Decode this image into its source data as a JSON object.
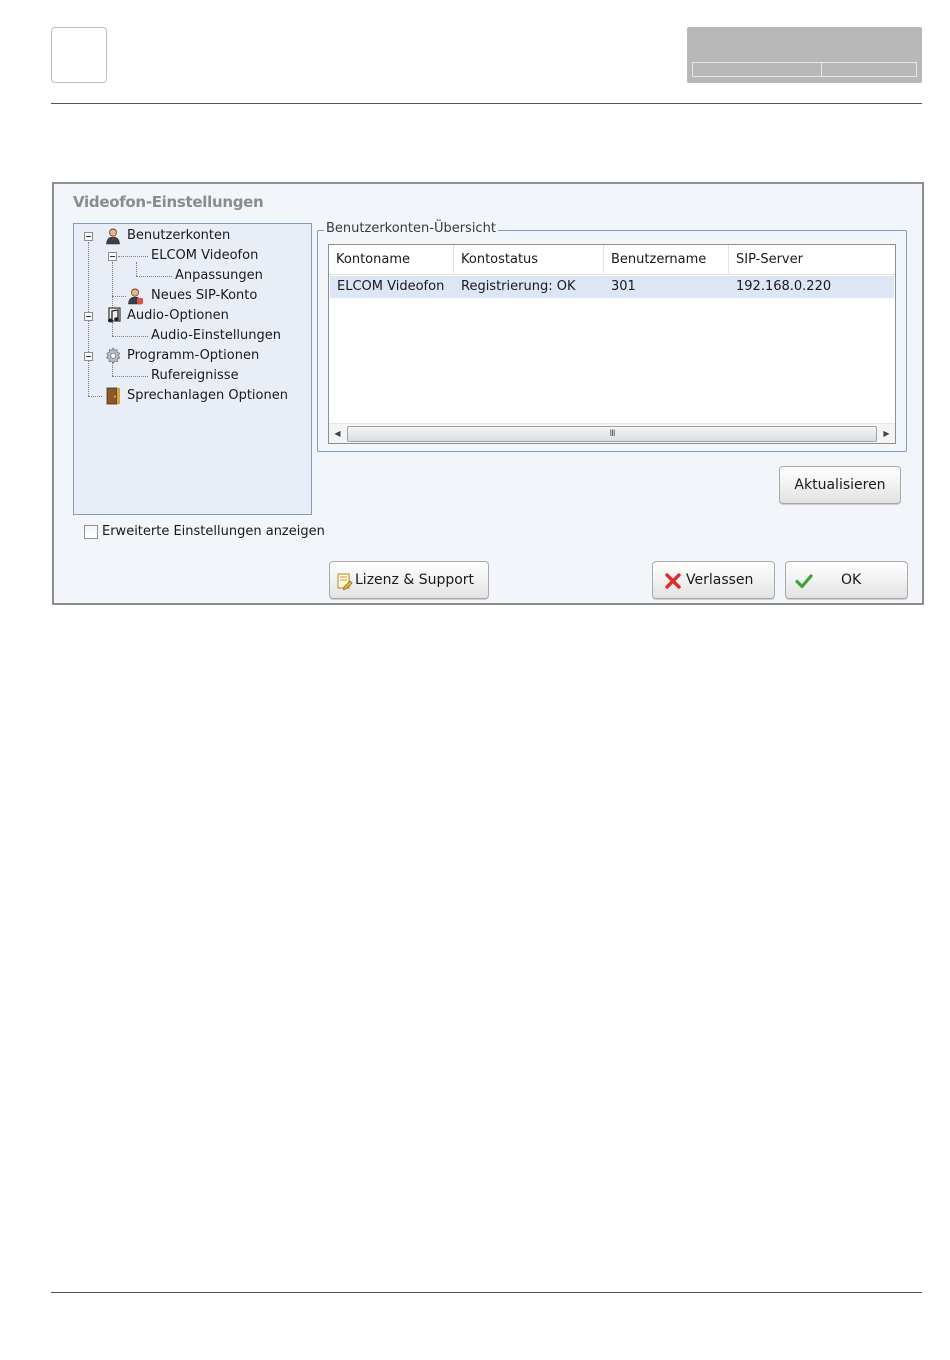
{
  "dialog": {
    "title": "Videofon-Einstellungen"
  },
  "tree": {
    "items": [
      {
        "label": "Benutzerkonten",
        "icon": "user-icon",
        "level": 0,
        "expanded": true,
        "selected": true
      },
      {
        "label": "ELCOM Videofon",
        "icon": "",
        "level": 1,
        "expanded": true
      },
      {
        "label": "Anpassungen",
        "icon": "",
        "level": 2
      },
      {
        "label": "Neues SIP-Konto",
        "icon": "add-user-icon",
        "level": 1
      },
      {
        "label": "Audio-Optionen",
        "icon": "music-note-icon",
        "level": 0,
        "expanded": true
      },
      {
        "label": "Audio-Einstellungen",
        "icon": "",
        "level": 1
      },
      {
        "label": "Programm-Optionen",
        "icon": "gear-icon",
        "level": 0,
        "expanded": true
      },
      {
        "label": "Rufereignisse",
        "icon": "",
        "level": 1
      },
      {
        "label": "Sprechanlagen Optionen",
        "icon": "door-icon",
        "level": 0
      }
    ]
  },
  "advanced": {
    "label": "Erweiterte Einstellungen anzeigen",
    "checked": false
  },
  "accounts": {
    "legend": "Benutzerkonten-Übersicht",
    "columns": [
      "Kontoname",
      "Kontostatus",
      "Benutzername",
      "SIP-Server"
    ],
    "rows": [
      [
        "ELCOM Videofon",
        "Registrierung: OK",
        "301",
        "192.168.0.220"
      ]
    ],
    "scroll_grip": "III"
  },
  "buttons": {
    "refresh": "Aktualisieren",
    "license": "Lizenz & Support",
    "exit": "Verlassen",
    "ok": "OK"
  },
  "colors": {
    "dialog_bg": "#f2f5fa",
    "tree_bg": "#e9eef6",
    "row_selected": "#dde6f4",
    "border_blue": "#7f9db9"
  }
}
